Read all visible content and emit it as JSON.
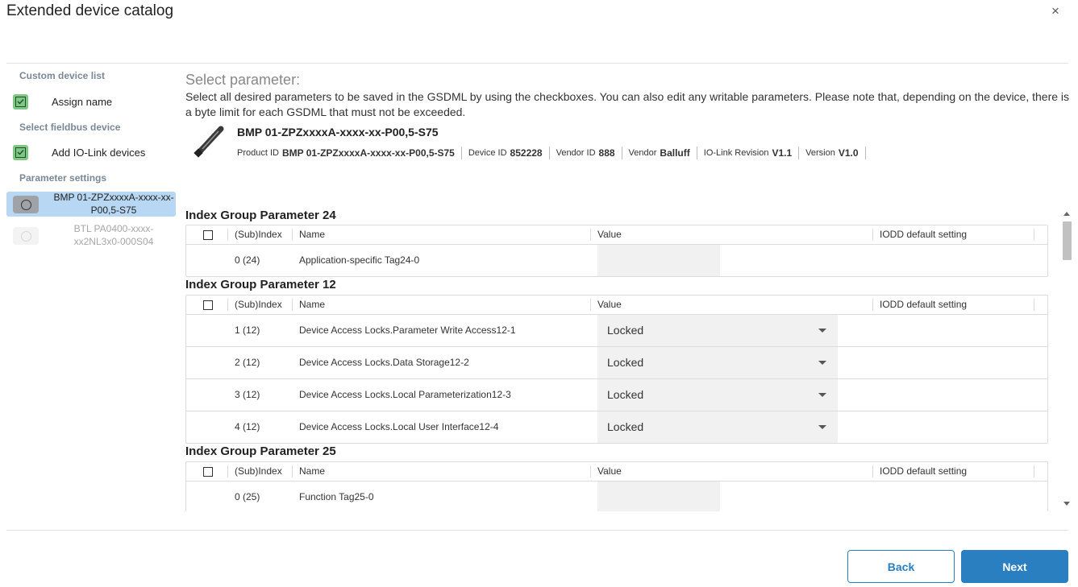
{
  "dialog": {
    "title": "Extended device catalog",
    "close_glyph": "×"
  },
  "sidebar": {
    "custom_device_list": {
      "heading": "Custom device list",
      "item_label": "Assign name"
    },
    "select_fieldbus_device": {
      "heading": "Select fieldbus device",
      "item_label": "Add IO-Link devices"
    },
    "parameter_settings": {
      "heading": "Parameter settings",
      "devices": [
        {
          "line1": "BMP 01-ZPZxxxxA-xxxx-xx-",
          "line2": "P00,5-S75",
          "selected": true
        },
        {
          "line1": "BTL PA0400-xxxx-",
          "line2": "xx2NL3x0-000S04",
          "selected": false
        }
      ]
    }
  },
  "main": {
    "title": "Select parameter:",
    "description": "Select all desired parameters to be saved in the GSDML by using the checkboxes. You can also edit any writable parameters. Please note that, depending on the device, there is a byte limit for each GSDML that must not be exceeded.",
    "device": {
      "name": "BMP 01-ZPZxxxxA-xxxx-xx-P00,5-S75",
      "meta": [
        {
          "label": "Product ID",
          "value": "BMP 01-ZPZxxxxA-xxxx-xx-P00,5-S75"
        },
        {
          "label": "Device ID",
          "value": "852228"
        },
        {
          "label": "Vendor ID",
          "value": "888"
        },
        {
          "label": "Vendor",
          "value": "Balluff"
        },
        {
          "label": "IO-Link Revision",
          "value": "V1.1"
        },
        {
          "label": "Version",
          "value": "V1.0"
        }
      ]
    },
    "columns": {
      "subindex": "(Sub)Index",
      "name": "Name",
      "value": "Value",
      "default": "IODD default setting"
    },
    "groups": [
      {
        "title": "Index Group Parameter 24",
        "rows": [
          {
            "index": "0 (24)",
            "name": "Application-specific Tag24-0",
            "value": ""
          }
        ]
      },
      {
        "title": "Index Group Parameter 12",
        "rows": [
          {
            "index": "1 (12)",
            "name": "Device Access Locks.Parameter Write Access12-1",
            "value": "Locked"
          },
          {
            "index": "2 (12)",
            "name": "Device Access Locks.Data Storage12-2",
            "value": "Locked"
          },
          {
            "index": "3 (12)",
            "name": "Device Access Locks.Local Parameterization12-3",
            "value": "Locked"
          },
          {
            "index": "4 (12)",
            "name": "Device Access Locks.Local User Interface12-4",
            "value": "Locked"
          }
        ]
      },
      {
        "title": "Index Group Parameter 25",
        "rows": [
          {
            "index": "0 (25)",
            "name": "Function Tag25-0",
            "value": ""
          }
        ]
      }
    ]
  },
  "footer": {
    "back_label": "Back",
    "next_label": "Next"
  },
  "colors": {
    "accent": "#2a7fc1",
    "selected_bg": "#b7d7f2",
    "check_green": "#7fc785"
  },
  "icons": [
    "close-icon",
    "check-icon",
    "radio-icon",
    "device-image",
    "chevron-down-icon",
    "scroll-up-icon",
    "scroll-down-icon"
  ]
}
